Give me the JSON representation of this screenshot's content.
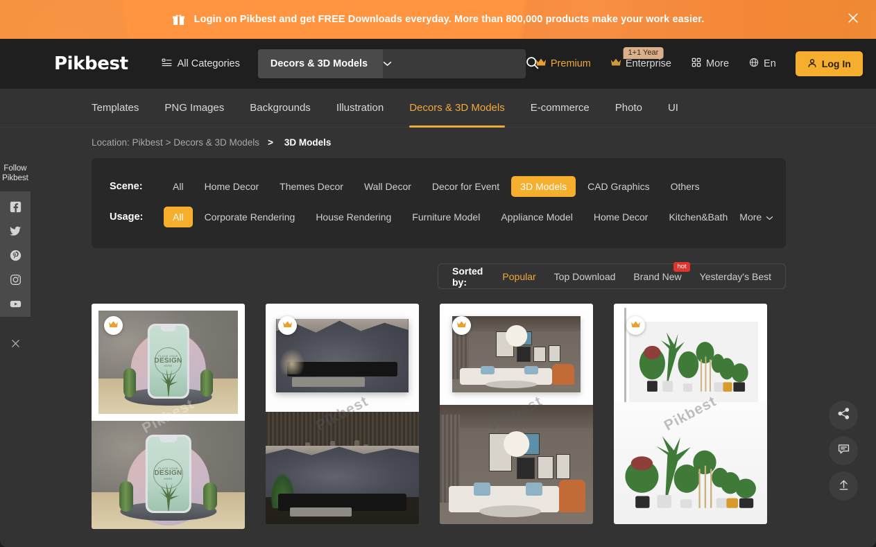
{
  "promo": {
    "text": "Login on Pikbest and get FREE Downloads everyday. More than 800,000 products make your work easier.",
    "gift_icon": "gift-icon",
    "close_icon": "close-icon",
    "bg_color": "#f2872f"
  },
  "header": {
    "logo": "Pikbest",
    "all_categories": "All Categories",
    "all_categories_icon": "grid-list-icon",
    "search": {
      "category": "Decors & 3D Models",
      "chevron_icon": "chevron-down-icon",
      "value": "",
      "placeholder": "",
      "search_icon": "search-icon"
    },
    "premium": "Premium",
    "premium_icon": "crown-icon",
    "enterprise": "Enterprise",
    "enterprise_icon": "crown-icon",
    "enterprise_badge": "1+1 Year",
    "more": "More",
    "more_icon": "grid-dots-icon",
    "language": "En",
    "language_icon": "globe-icon",
    "login": "Log In",
    "login_icon": "user-icon",
    "accent_color": "#f5ae2e"
  },
  "nav": {
    "tabs": [
      {
        "label": "Templates",
        "active": false
      },
      {
        "label": "PNG Images",
        "active": false
      },
      {
        "label": "Backgrounds",
        "active": false
      },
      {
        "label": "Illustration",
        "active": false
      },
      {
        "label": "Decors & 3D Models",
        "active": true
      },
      {
        "label": "E-commerce",
        "active": false
      },
      {
        "label": "Photo",
        "active": false
      },
      {
        "label": "UI",
        "active": false
      }
    ]
  },
  "breadcrumb": {
    "prefix": "Location: Pikbest > Decors & 3D Models",
    "separator": ">",
    "current": "3D Models"
  },
  "filters": {
    "scene": {
      "label": "Scene:",
      "options": [
        {
          "label": "All",
          "active": false
        },
        {
          "label": "Home Decor",
          "active": false
        },
        {
          "label": "Themes Decor",
          "active": false
        },
        {
          "label": "Wall Decor",
          "active": false
        },
        {
          "label": "Decor for Event",
          "active": false
        },
        {
          "label": "3D Models",
          "active": true
        },
        {
          "label": "CAD Graphics",
          "active": false
        },
        {
          "label": "Others",
          "active": false
        }
      ]
    },
    "usage": {
      "label": "Usage:",
      "options": [
        {
          "label": "All",
          "active": true
        },
        {
          "label": "Corporate Rendering",
          "active": false
        },
        {
          "label": "House Rendering",
          "active": false
        },
        {
          "label": "Furniture Model",
          "active": false
        },
        {
          "label": "Appliance Model",
          "active": false
        },
        {
          "label": "Home Decor",
          "active": false
        },
        {
          "label": "Kitchen&Bath",
          "active": false
        }
      ],
      "more": "More",
      "more_icon": "chevron-down-icon"
    }
  },
  "sort": {
    "label": "Sorted by:",
    "options": [
      {
        "label": "Popular",
        "active": true,
        "badge": ""
      },
      {
        "label": "Top Download",
        "active": false,
        "badge": ""
      },
      {
        "label": "Brand New",
        "active": false,
        "badge": "hot"
      },
      {
        "label": "Yesterday's Best",
        "active": false,
        "badge": ""
      }
    ]
  },
  "follow_rail": {
    "title": "Follow\nPikbest",
    "title_line1": "Follow",
    "title_line2": "Pikbest",
    "icons": [
      "facebook-icon",
      "twitter-icon",
      "pinterest-icon",
      "instagram-icon",
      "youtube-icon"
    ],
    "close_icon": "close-icon"
  },
  "float_buttons": [
    {
      "name": "share-icon"
    },
    {
      "name": "feedback-icon"
    },
    {
      "name": "back-to-top-icon"
    }
  ],
  "products": [
    {
      "id": 1,
      "badge_icon": "crown-icon",
      "watermark": "Pikbest",
      "design_top": "PLACE YOUR",
      "design_mid": "DESIGN",
      "design_bot": "HERE"
    },
    {
      "id": 2,
      "badge_icon": "crown-icon",
      "watermark": "Pikbest"
    },
    {
      "id": 3,
      "badge_icon": "crown-icon",
      "watermark": "Pikbest"
    },
    {
      "id": 4,
      "badge_icon": "crown-icon",
      "watermark": "Pikbest"
    }
  ]
}
